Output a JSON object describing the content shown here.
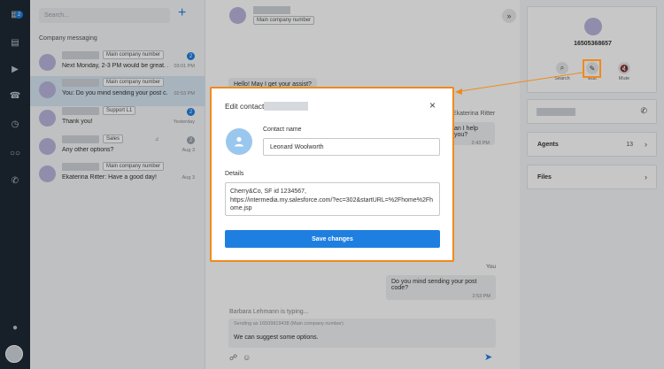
{
  "sidebar": {
    "chat_badge": "2",
    "icons": [
      "chat-icon",
      "messages-icon",
      "video-icon",
      "calls-icon",
      "history-icon",
      "voicemail-icon",
      "phone-forward-icon",
      "support-chat-icon"
    ]
  },
  "list": {
    "search_placeholder": "Search...",
    "add_label": "+",
    "section_title": "Company messaging",
    "conversations": [
      {
        "tag": "Main company number",
        "message": "Next Monday, 2-3 PM would be great. ...",
        "time": "03:01 PM",
        "badge": "2"
      },
      {
        "tag": "Main company number",
        "message": "You: Do you mind sending your post c...",
        "time": "02:53 PM",
        "badge": ""
      },
      {
        "tag": "Support L1",
        "message": "Thank you!",
        "time": "Yesterday",
        "badge": "2"
      },
      {
        "tag": "Sales",
        "message": "Any other options?",
        "time": "Aug 3",
        "badge": "2"
      },
      {
        "tag": "Main company number",
        "message": "Ekaterina Ritter: Have a good day!",
        "time": "Aug 3",
        "badge": ""
      }
    ]
  },
  "chat": {
    "header_tag": "Main company number",
    "collapse_label": "»",
    "bubble_1": "Hello! May I get your assist?",
    "agent_name": "Ekaterina Ritter",
    "agent_bubble": "an I help you?",
    "agent_time": "2:43 PM",
    "you_label": "You",
    "you_bubble": "Do you mind sending your post code?",
    "you_time": "2:53 PM",
    "typing": "Barbara Lehmann is typing...",
    "sending_as": "Sending as 16509819438 (Main company number)",
    "compose_text": "We can suggest some options.",
    "send_glyph": "➤"
  },
  "details": {
    "number": "16505368657",
    "actions": [
      {
        "label": "Search",
        "glyph": "⌕"
      },
      {
        "label": "Edit",
        "glyph": "✎"
      },
      {
        "label": "Mute",
        "glyph": "🔇"
      }
    ],
    "phone_glyph": "✆",
    "agents_label": "Agents",
    "agents_count": "13",
    "files_label": "Files",
    "chevron": "›"
  },
  "modal": {
    "title": "Edit contact",
    "close": "×",
    "name_label": "Contact name",
    "name_value": "Leonard Woolworth",
    "details_label": "Details",
    "details_value": "Cherry&Co, SF id 1234567,\nhttps://intermedia.my.salesforce.com/?ec=302&startURL=%2Fhome%2Fhome.jsp",
    "save_label": "Save changes"
  },
  "colors": {
    "accent": "#1f7fe0",
    "highlight": "#f08a1c",
    "rail": "#1e2a35"
  }
}
